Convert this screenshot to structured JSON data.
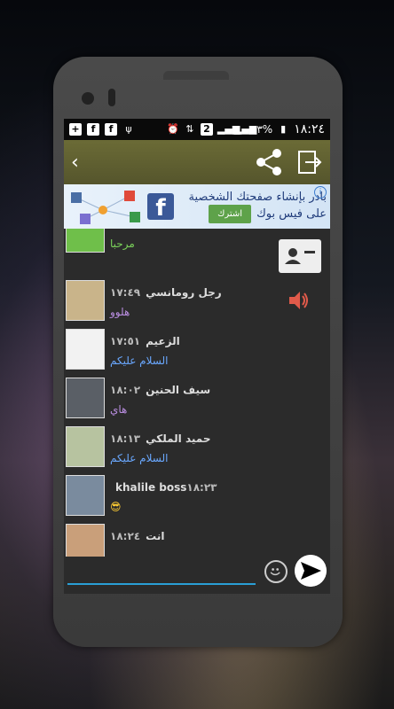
{
  "status": {
    "time": "١٨:٢٤",
    "battery": "٦٣%",
    "sim": "2"
  },
  "appbar": {
    "back": "‹"
  },
  "ad": {
    "line1": "بادر بإنشاء صفحتك الشخصية",
    "line2": "على فيس بوك",
    "button": "اشترك",
    "fb_letter": "f",
    "info": "i"
  },
  "messages": [
    {
      "time": "",
      "name": "",
      "text": "مرحبا",
      "text_color": "#7bd35b",
      "avatar_color": "#6fbf4a"
    },
    {
      "time": "١٧:٤٩",
      "name": "رجل رومانسي",
      "text": "هلوو",
      "text_color": "#b98de0",
      "avatar_color": "#c9b48a"
    },
    {
      "time": "١٧:٥١",
      "name": "الزعيم",
      "text": "السلام عليكم",
      "text_color": "#6aa8ff",
      "avatar_color": "#f2f2f2"
    },
    {
      "time": "١٨:٠٢",
      "name": "سيف الحنين",
      "text": "هاي",
      "text_color": "#b98de0",
      "avatar_color": "#5a5f66"
    },
    {
      "time": "١٨:١٣",
      "name": "حميد الملكي",
      "text": "السلام عليكم",
      "text_color": "#6aa8ff",
      "avatar_color": "#b7c3a0"
    },
    {
      "time": "١٨:٢٣",
      "name": "khalile boss",
      "text": "😎",
      "text_color": "#ffcc33",
      "avatar_color": "#7a8b9e"
    },
    {
      "time": "١٨:٢٤",
      "name": "انت",
      "text": ".",
      "text_color": "#ffffff",
      "avatar_color": "#c99f7a"
    }
  ],
  "colors": {
    "appbar": "#5f5f31",
    "speaker": "#e05a4a",
    "input_line": "#2a9fd6"
  },
  "icons": [
    "back-icon",
    "share-icon",
    "exit-icon",
    "contact-card-icon",
    "speaker-icon",
    "emoji-icon",
    "send-icon"
  ]
}
